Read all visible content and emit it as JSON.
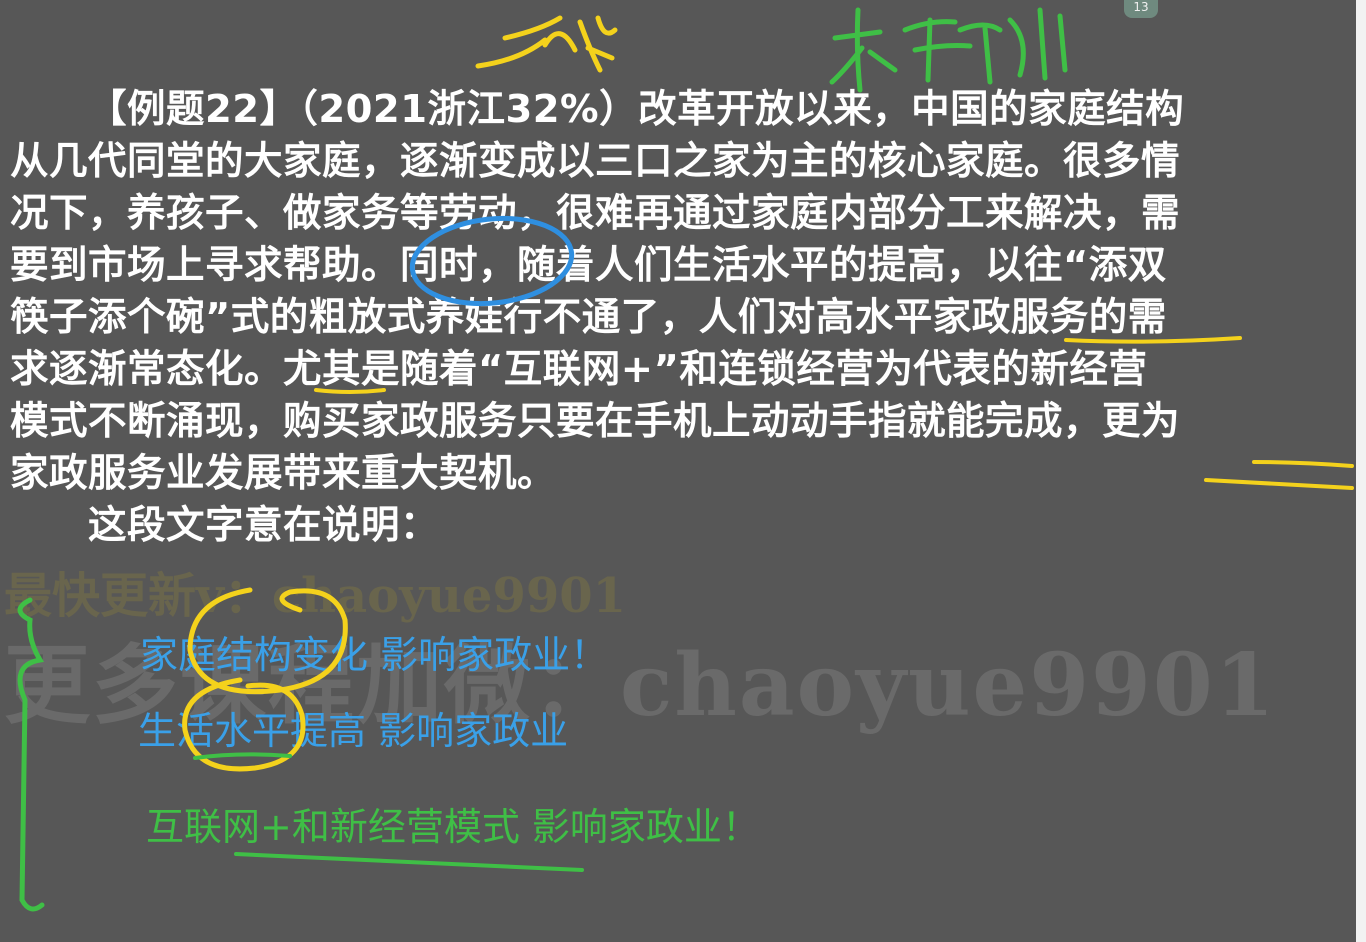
{
  "page_badge": "13",
  "passage": {
    "lines": [
      "【例题22】（2021浙江32%）改革开放以来，中国的家庭结构",
      "从几代同堂的大家庭，逐渐变成以三口之家为主的核心家庭。很多情",
      "况下，养孩子、做家务等劳动，很难再通过家庭内部分工来解决，需",
      "要到市场上寻求帮助。同时，随着人们生活水平的提高，以往“添双",
      "筷子添个碗”式的粗放式养娃行不通了，人们对高水平家政服务的需",
      "求逐渐常态化。尤其是随着“互联网+”和连锁经营为代表的新经营",
      "模式不断涌现，购买家政服务只要在手机上动动手指就能完成，更为",
      "家政服务业发展带来重大契机。"
    ],
    "question": "这段文字意在说明："
  },
  "watermark": {
    "small": "最快更新v：chaoyue9901",
    "big": "更多课程加微：chaoyue9901"
  },
  "notes": [
    "家庭结构变化 影响家政业！",
    "生活水平提高 影响家政业",
    "互联网+和新经营模式 影响家政业！"
  ],
  "colors": {
    "background": "#575757",
    "passage_text": "#ffffff",
    "yellow_ink": "#f4d21c",
    "blue_ink": "#2f8fe0",
    "green_ink": "#3fbf46"
  }
}
